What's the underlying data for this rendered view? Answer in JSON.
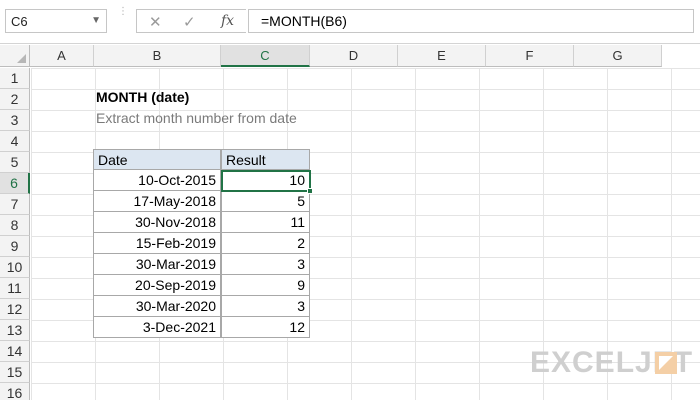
{
  "formula_bar": {
    "name_box": "C6",
    "name_box_arrow": "▼",
    "separator": "⋮",
    "cancel": "✕",
    "enter": "✓",
    "fx": "fx",
    "formula": "=MONTH(B6)"
  },
  "columns": [
    "A",
    "B",
    "C",
    "D",
    "E",
    "F",
    "G"
  ],
  "selected_column": "C",
  "rows": [
    "1",
    "2",
    "3",
    "4",
    "5",
    "6",
    "7",
    "8",
    "9",
    "10",
    "11",
    "12",
    "13",
    "14",
    "15",
    "16"
  ],
  "selected_row": "6",
  "sheet": {
    "title": "MONTH (date)",
    "subtitle": "Extract month number from date"
  },
  "table": {
    "headers": [
      "Date",
      "Result"
    ],
    "rows": [
      {
        "date": "10-Oct-2015",
        "result": "10"
      },
      {
        "date": "17-May-2018",
        "result": "5"
      },
      {
        "date": "30-Nov-2018",
        "result": "11"
      },
      {
        "date": "15-Feb-2019",
        "result": "2"
      },
      {
        "date": "30-Mar-2019",
        "result": "3"
      },
      {
        "date": "20-Sep-2019",
        "result": "9"
      },
      {
        "date": "30-Mar-2020",
        "result": "3"
      },
      {
        "date": "3-Dec-2021",
        "result": "12"
      }
    ]
  },
  "active_cell": "C6",
  "watermark": "EXCELJET",
  "colors": {
    "header_fill": "#dce6f1",
    "selection": "#217346",
    "brand": "#f4cfa6"
  }
}
